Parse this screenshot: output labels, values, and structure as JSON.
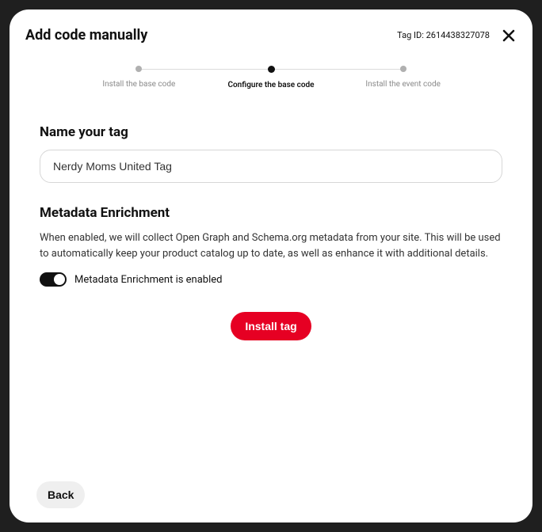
{
  "header": {
    "title": "Add code manually",
    "tag_id_label": "Tag ID: 2614438327078"
  },
  "stepper": {
    "steps": [
      {
        "label": "Install the base code",
        "active": false
      },
      {
        "label": "Configure the base code",
        "active": true
      },
      {
        "label": "Install the event code",
        "active": false
      }
    ]
  },
  "name_section": {
    "title": "Name your tag",
    "value": "Nerdy Moms United Tag"
  },
  "metadata_section": {
    "title": "Metadata Enrichment",
    "description": "When enabled, we will collect Open Graph and Schema.org metadata from your site. This will be used to automatically keep your product catalog up to date, as well as enhance it with additional details.",
    "toggle_label": "Metadata Enrichment is enabled",
    "toggle_on": true
  },
  "actions": {
    "install_label": "Install tag",
    "back_label": "Back"
  }
}
